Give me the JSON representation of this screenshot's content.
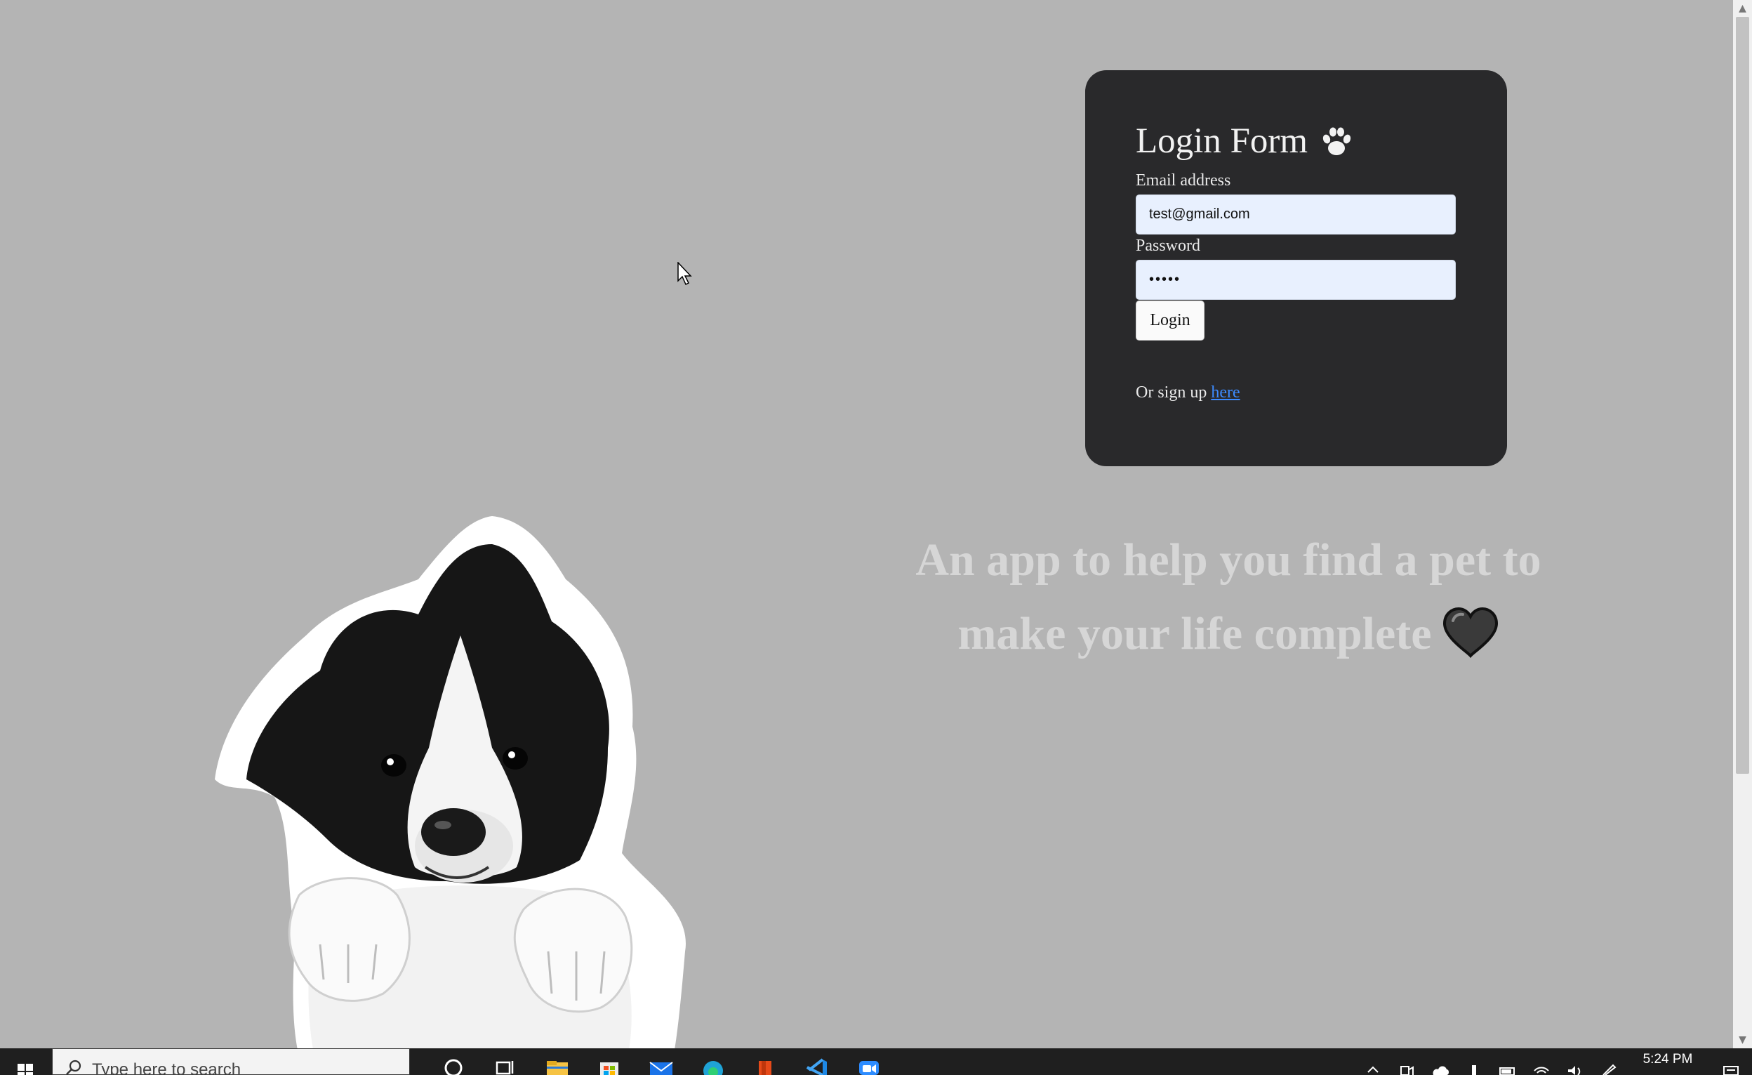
{
  "login": {
    "title": "Login Form",
    "email_label": "Email address",
    "email_value": "test@gmail.com",
    "password_label": "Password",
    "password_value": "•••••",
    "login_button": "Login",
    "signup_prefix": "Or sign up ",
    "signup_link": "here"
  },
  "tagline": {
    "line1": "An app to help you find a pet to",
    "line2": "make your life complete"
  },
  "taskbar": {
    "search_placeholder": "Type here to search",
    "time": "5:24 PM",
    "pinned_apps": [
      "cortana-icon",
      "task-view-icon",
      "file-explorer-icon",
      "store-icon",
      "mail-icon",
      "edge-icon",
      "office-icon",
      "vscode-icon",
      "zoom-icon"
    ],
    "tray_icons": [
      "chevron-up-icon",
      "meet-now-icon",
      "onedrive-icon",
      "pen-icon",
      "battery-icon",
      "wifi-icon",
      "volume-icon",
      "pen-workspace-icon"
    ]
  },
  "colors": {
    "page_background": "#b4b4b4",
    "card_background": "#29292b",
    "link": "#3d8bff",
    "input_background": "#e8f0fe",
    "tagline_text": "#d6d6d6",
    "taskbar": "#1f1f1f"
  }
}
